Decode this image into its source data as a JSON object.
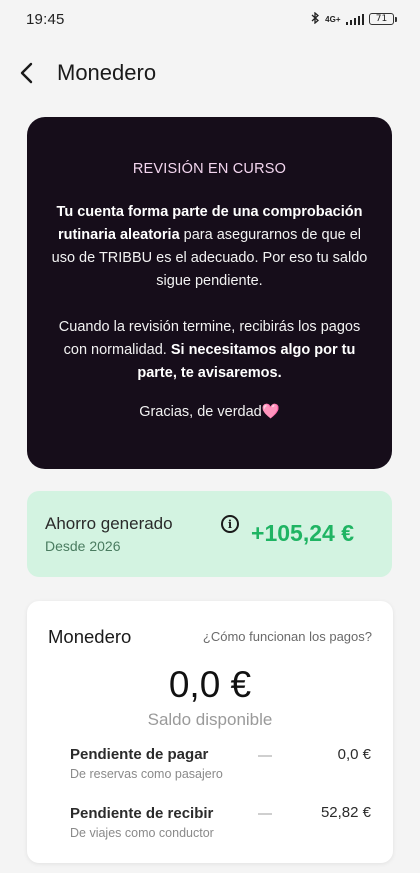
{
  "status_bar": {
    "time": "19:45",
    "network": "4G+",
    "battery": "71"
  },
  "header": {
    "title": "Monedero"
  },
  "review": {
    "title": "REVISIÓN EN CURSO",
    "p1_bold": "Tu cuenta forma parte de una comprobación rutinaria aleatoria",
    "p1_rest": " para asegurarnos de que el uso de TRIBBU es el adecuado. Por eso tu saldo sigue pendiente.",
    "p2_start": "Cuando la revisión termine, recibirás los pagos con normalidad. ",
    "p2_bold": "Si necesitamos algo por tu parte, te avisaremos.",
    "thanks": "Gracias, de verdad",
    "heart": "🩷"
  },
  "savings": {
    "label": "Ahorro generado",
    "sub": "Desde 2026",
    "amount": "+105,24 €",
    "amount_color": "#1fb463"
  },
  "wallet": {
    "title": "Monedero",
    "help_link": "¿Cómo funcionan los pagos?",
    "balance": "0,0 €",
    "balance_label": "Saldo disponible",
    "rows": [
      {
        "title": "Pendiente de pagar",
        "sub": "De reservas como pasajero",
        "value": "0,0 €"
      },
      {
        "title": "Pendiente de recibir",
        "sub": "De viajes como conductor",
        "value": "52,82 €"
      }
    ]
  }
}
